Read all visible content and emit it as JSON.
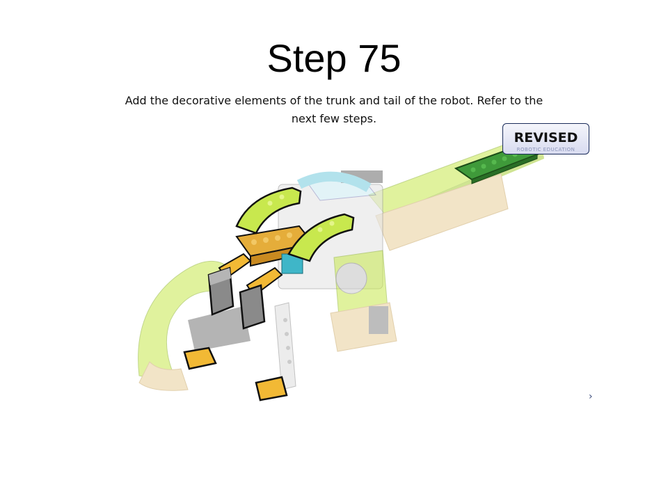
{
  "slide": {
    "title": "Step 75",
    "instructions": "Add the decorative elements of the trunk and tail of the robot. Refer to the next few steps.",
    "badge": {
      "label": "REVISED",
      "subtext": "ROBOTIC EDUCATION"
    },
    "nav_arrow": "›"
  },
  "colors": {
    "lime": "#c8e84e",
    "lime_dark": "#a9cf3a",
    "tan": "#e9cf9a",
    "gray": "#8a8a8a",
    "yellow_orange": "#f2b935",
    "teal": "#3fb6c8",
    "green": "#3f9a3a",
    "light_gray": "#d9d9d9"
  }
}
